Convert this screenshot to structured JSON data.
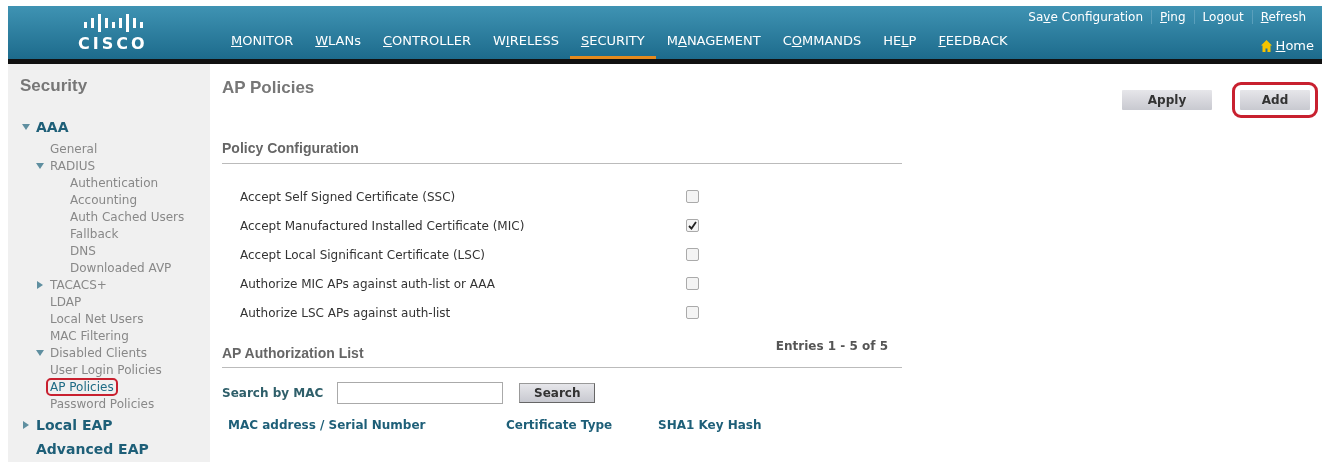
{
  "header": {
    "logo": "CISCO",
    "top_links": [
      {
        "before": "Sa",
        "key": "v",
        "after": "e Configuration"
      },
      {
        "key": "P",
        "after": "ing"
      },
      {
        "before": "Logout"
      },
      {
        "key": "R",
        "after": "efresh"
      }
    ],
    "nav": [
      {
        "key": "M",
        "after": "ONITOR",
        "selected": false
      },
      {
        "key": "W",
        "after": "LANs",
        "selected": false
      },
      {
        "key": "C",
        "after": "ONTROLLER",
        "selected": false
      },
      {
        "before": "W",
        "key": "I",
        "after": "RELESS",
        "selected": false
      },
      {
        "key": "S",
        "after": "ECURITY",
        "selected": true
      },
      {
        "before": "M",
        "key": "A",
        "after": "NAGEMENT",
        "selected": false
      },
      {
        "before": "C",
        "key": "O",
        "after": "MMANDS",
        "selected": false
      },
      {
        "before": "HE",
        "key": "L",
        "after": "P",
        "selected": false
      },
      {
        "key": "F",
        "after": "EEDBACK",
        "selected": false
      }
    ],
    "home": {
      "key": "H",
      "after": "ome"
    }
  },
  "sidebar": {
    "title": "Security",
    "items": [
      {
        "label": "AAA",
        "kind": "section",
        "expanded": true,
        "selected": false,
        "children": [
          {
            "label": "General",
            "selected": false
          },
          {
            "label": "RADIUS",
            "expanded": true,
            "selected": false,
            "children": [
              {
                "label": "Authentication",
                "selected": false
              },
              {
                "label": "Accounting",
                "selected": false
              },
              {
                "label": "Auth Cached Users",
                "selected": false
              },
              {
                "label": "Fallback",
                "selected": false
              },
              {
                "label": "DNS",
                "selected": false
              },
              {
                "label": "Downloaded AVP",
                "selected": false
              }
            ]
          },
          {
            "label": "TACACS+",
            "expanded": false,
            "selected": false
          },
          {
            "label": "LDAP",
            "selected": false
          },
          {
            "label": "Local Net Users",
            "selected": false
          },
          {
            "label": "MAC Filtering",
            "selected": false
          },
          {
            "label": "Disabled Clients",
            "expanded": true,
            "selected": false
          },
          {
            "label": "User Login Policies",
            "selected": false
          },
          {
            "label": "AP Policies",
            "selected": true,
            "highlighted": true
          },
          {
            "label": "Password Policies",
            "selected": false
          }
        ]
      },
      {
        "label": "Local EAP",
        "kind": "section",
        "expanded": false,
        "selected": false
      },
      {
        "label": "Advanced EAP",
        "kind": "section",
        "selected": false
      }
    ]
  },
  "page": {
    "title": "AP Policies",
    "buttons": [
      {
        "label": "Apply",
        "highlighted": false
      },
      {
        "label": "Add",
        "highlighted": true
      }
    ],
    "policy_section": {
      "title": "Policy Configuration",
      "rows": [
        {
          "label": "Accept Self Signed Certificate (SSC)",
          "checked": false
        },
        {
          "label": "Accept Manufactured Installed Certificate (MIC)",
          "checked": true
        },
        {
          "label": "Accept Local Significant Certificate (LSC)",
          "checked": false
        },
        {
          "label": "Authorize MIC APs against auth-list or AAA",
          "checked": false
        },
        {
          "label": "Authorize LSC APs against auth-list",
          "checked": false
        }
      ]
    },
    "auth_list": {
      "title": "AP Authorization List",
      "entries": "Entries 1 - 5 of 5",
      "search_label": "Search by MAC",
      "search_button": "Search",
      "columns": [
        "MAC address / Serial Number",
        "Certificate Type",
        "SHA1 Key Hash"
      ]
    }
  }
}
